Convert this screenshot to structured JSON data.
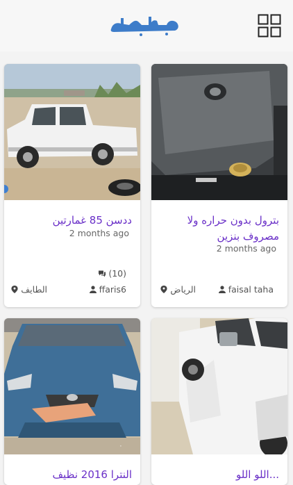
{
  "app": {
    "logo_text": "حراج",
    "brand_color": "#3d7cc9",
    "accent_color": "#6a30c8",
    "grid_icon": "grid-icon"
  },
  "listings": [
    {
      "title": "بترول بدون حراره ولا مصروف بنزين",
      "time": "2 months ago",
      "author": "faisal taha",
      "city": "الرياض",
      "comments": ""
    },
    {
      "title": "ددسن 85 غمارتين",
      "time": "2 months ago",
      "author": "ffaris6",
      "city": "الطايف",
      "comments": "(10)"
    },
    {
      "title": "...اللو اللو",
      "time": "",
      "author": "",
      "city": "",
      "comments": ""
    },
    {
      "title": "النترا 2016 نظيف",
      "time": "",
      "author": "",
      "city": "",
      "comments": ""
    }
  ]
}
